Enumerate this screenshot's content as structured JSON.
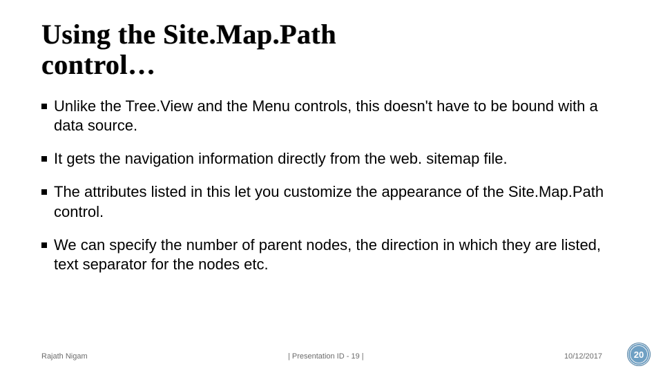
{
  "title_line1": "Using the Site.Map.Path",
  "title_line2": "control…",
  "bullets": [
    "Unlike the Tree.View and the Menu controls, this doesn't have to be bound with a data source.",
    "It gets the navigation information directly from the web. sitemap file.",
    "The attributes listed in this let you customize the appearance of the Site.Map.Path control.",
    "We can specify the number of parent nodes, the direction in which they are listed, text separator for the nodes etc."
  ],
  "footer": {
    "author": "Rajath Nigam",
    "presentation": "| Presentation ID - 19 |",
    "date": "10/12/2017"
  },
  "page_number": "20"
}
